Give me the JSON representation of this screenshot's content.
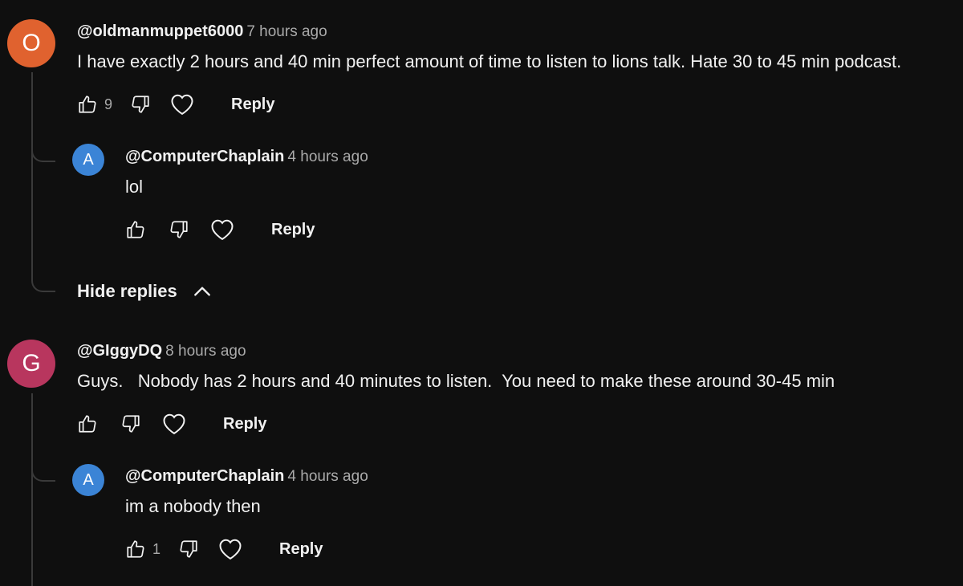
{
  "comments": [
    {
      "avatar_letter": "O",
      "avatar_color": "#e0622f",
      "handle": "@oldmanmuppet6000",
      "time": "7 hours ago",
      "text": "I have exactly 2 hours and 40 min perfect amount of time to listen to lions talk. Hate 30 to 45 min podcast.",
      "likes": "9",
      "reply_label": "Reply",
      "replies": [
        {
          "avatar_letter": "A",
          "avatar_color": "#3b84d6",
          "handle": "@ComputerChaplain",
          "time": "4 hours ago",
          "text": "lol",
          "likes": "",
          "reply_label": "Reply"
        }
      ],
      "hide_replies_label": "Hide replies"
    },
    {
      "avatar_letter": "G",
      "avatar_color": "#b8365e",
      "handle": "@GIggyDQ",
      "time": "8 hours ago",
      "text": "Guys.   Nobody has 2 hours and 40 minutes to listen.  You need to make these around 30-45 min",
      "likes": "",
      "reply_label": "Reply",
      "replies": [
        {
          "avatar_letter": "A",
          "avatar_color": "#3b84d6",
          "handle": "@ComputerChaplain",
          "time": "4 hours ago",
          "text": "im a nobody then",
          "likes": "1",
          "reply_label": "Reply"
        }
      ]
    }
  ]
}
